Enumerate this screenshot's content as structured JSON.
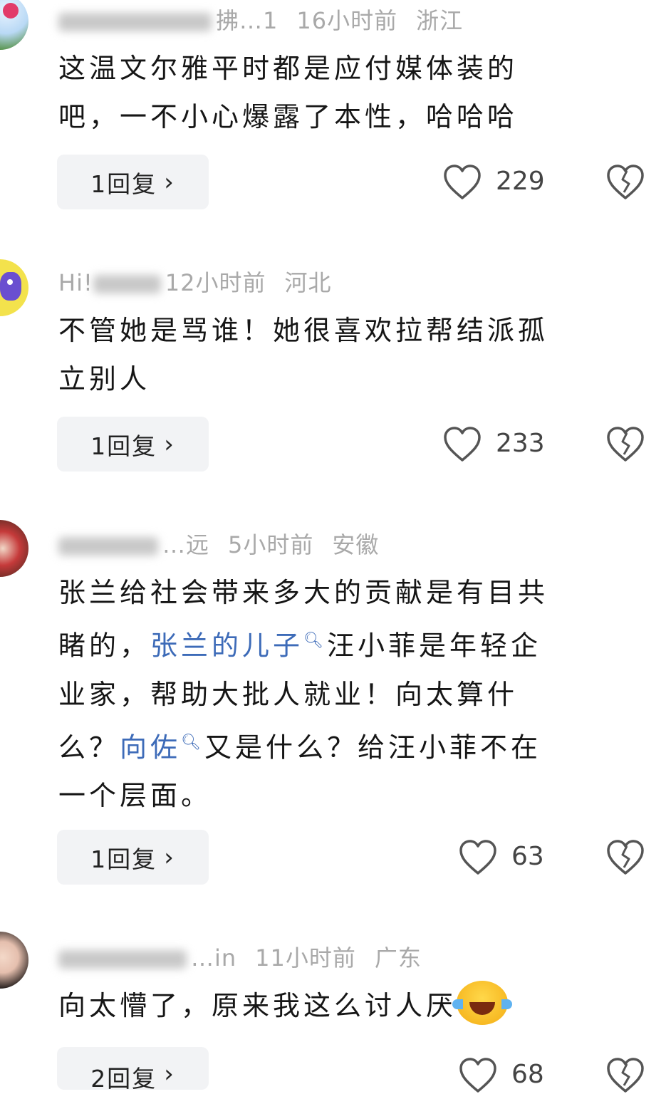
{
  "comments": [
    {
      "user": "拂…1",
      "time": "16小时前",
      "region": "浙江",
      "lines": [
        "这温文尔雅平时都是应付媒体装的",
        "吧，一不小心爆露了本性，哈哈哈"
      ],
      "reply_label": "1回复",
      "likes": "229"
    },
    {
      "user": "Hi!",
      "time": "12小时前",
      "region": "河北",
      "lines": [
        "不管她是骂谁！她很喜欢拉帮结派孤",
        "立别人"
      ],
      "reply_label": "1回复",
      "likes": "233"
    },
    {
      "user": "…远",
      "time": "5小时前",
      "region": "安徽",
      "line1": "张兰给社会带来多大的贡献是有目共",
      "line2_pre": "睹的，",
      "link1": "张兰的儿子",
      "line2_post": "汪小菲是年轻企",
      "line3": "业家，帮助大批人就业！向太算什",
      "line4_pre": "么？",
      "link2": "向佐",
      "line4_post": "又是什么？给汪小菲不在",
      "line5": "一个层面。",
      "reply_label": "1回复",
      "likes": "63"
    },
    {
      "user": "…in",
      "time": "11小时前",
      "region": "广东",
      "text": "向太懵了，原来我这么讨人厌",
      "emoji": "laughing-crying-emoji",
      "reply_label": "2回复",
      "likes": "68"
    }
  ],
  "icons": {
    "like": "heart-outline-icon",
    "dislike": "broken-heart-icon",
    "reply_chevron": "chevron-right-icon",
    "search": "search-icon"
  },
  "colors": {
    "link": "#3d6bb8",
    "meta": "#a9a9a9",
    "button_bg": "#f2f3f5"
  }
}
